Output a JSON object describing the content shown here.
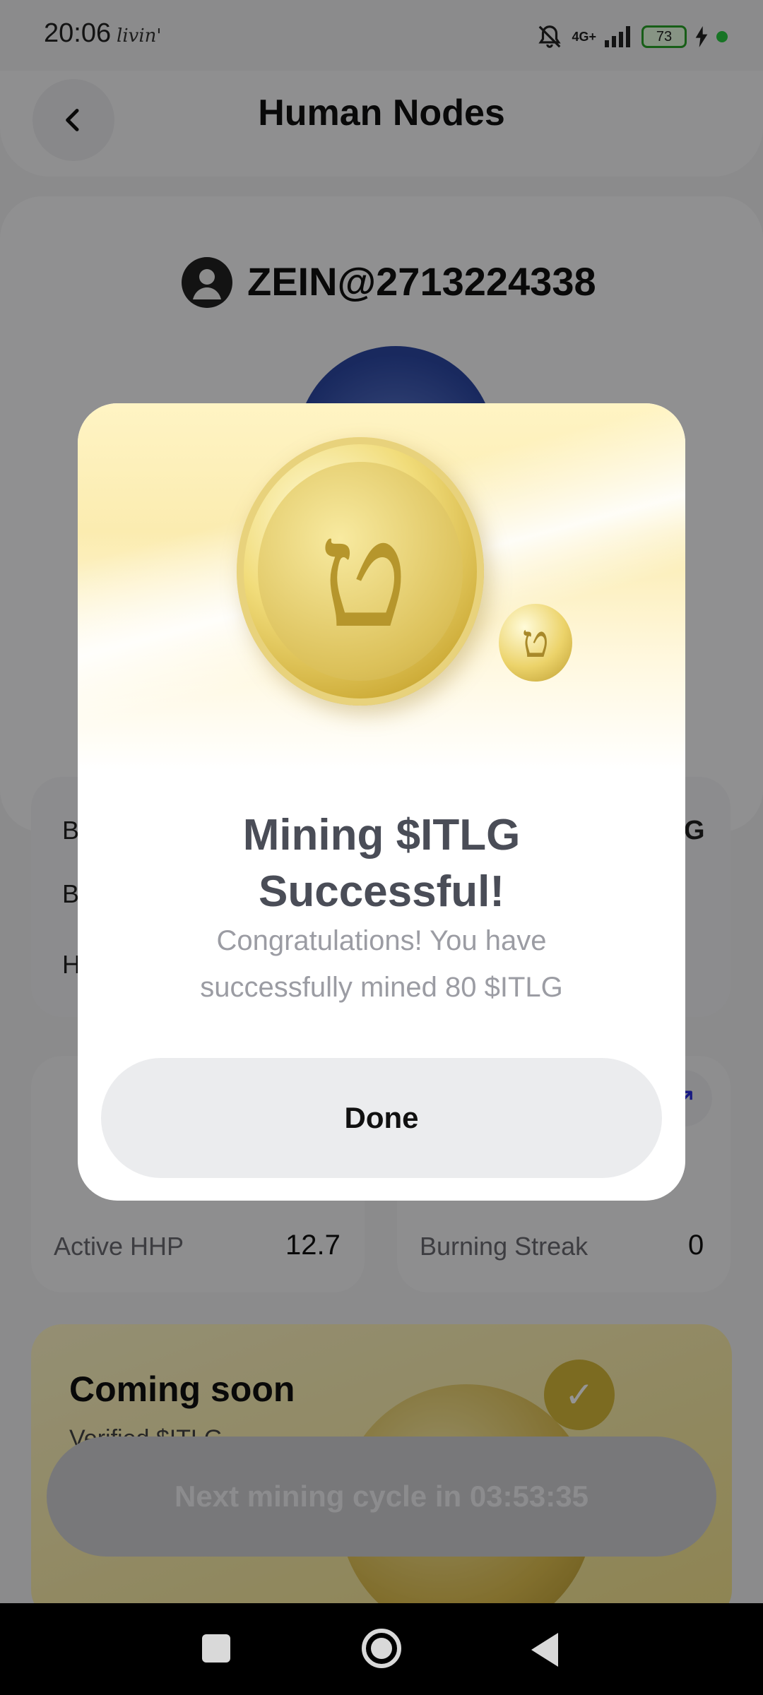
{
  "status_bar": {
    "time": "20:06",
    "brand": "livin'",
    "network": "4G+",
    "battery": "73"
  },
  "header": {
    "title": "Human Nodes"
  },
  "profile": {
    "username": "ZEIN@2713224338"
  },
  "info_card": {
    "rows": [
      "B",
      "B",
      "H"
    ],
    "right_value": "G"
  },
  "stats": {
    "active_hhp_label": "Active HHP",
    "active_hhp_value": "12.7",
    "burning_streak_label": "Burning Streak",
    "burning_streak_value": "0"
  },
  "coming_soon": {
    "title": "Coming soon",
    "subtitle": "Verified $ITLG"
  },
  "mining_button": {
    "label": "Next mining cycle in 03:53:35"
  },
  "modal": {
    "title_line1": "Mining $ITLG",
    "title_line2": "Successful!",
    "message": "Congratulations! You have successfully mined 80 $ITLG",
    "done_label": "Done"
  },
  "icons": {
    "back": "chevron-left-icon",
    "arrow": "arrow-up-right-icon",
    "check": "checkmark-icon",
    "coin": "itlg-coin-icon"
  },
  "colors": {
    "overlay": "#000000",
    "coin_gold": "#dcc15a",
    "accent_blue": "#2a2ee0",
    "battery_green": "#29a329"
  }
}
